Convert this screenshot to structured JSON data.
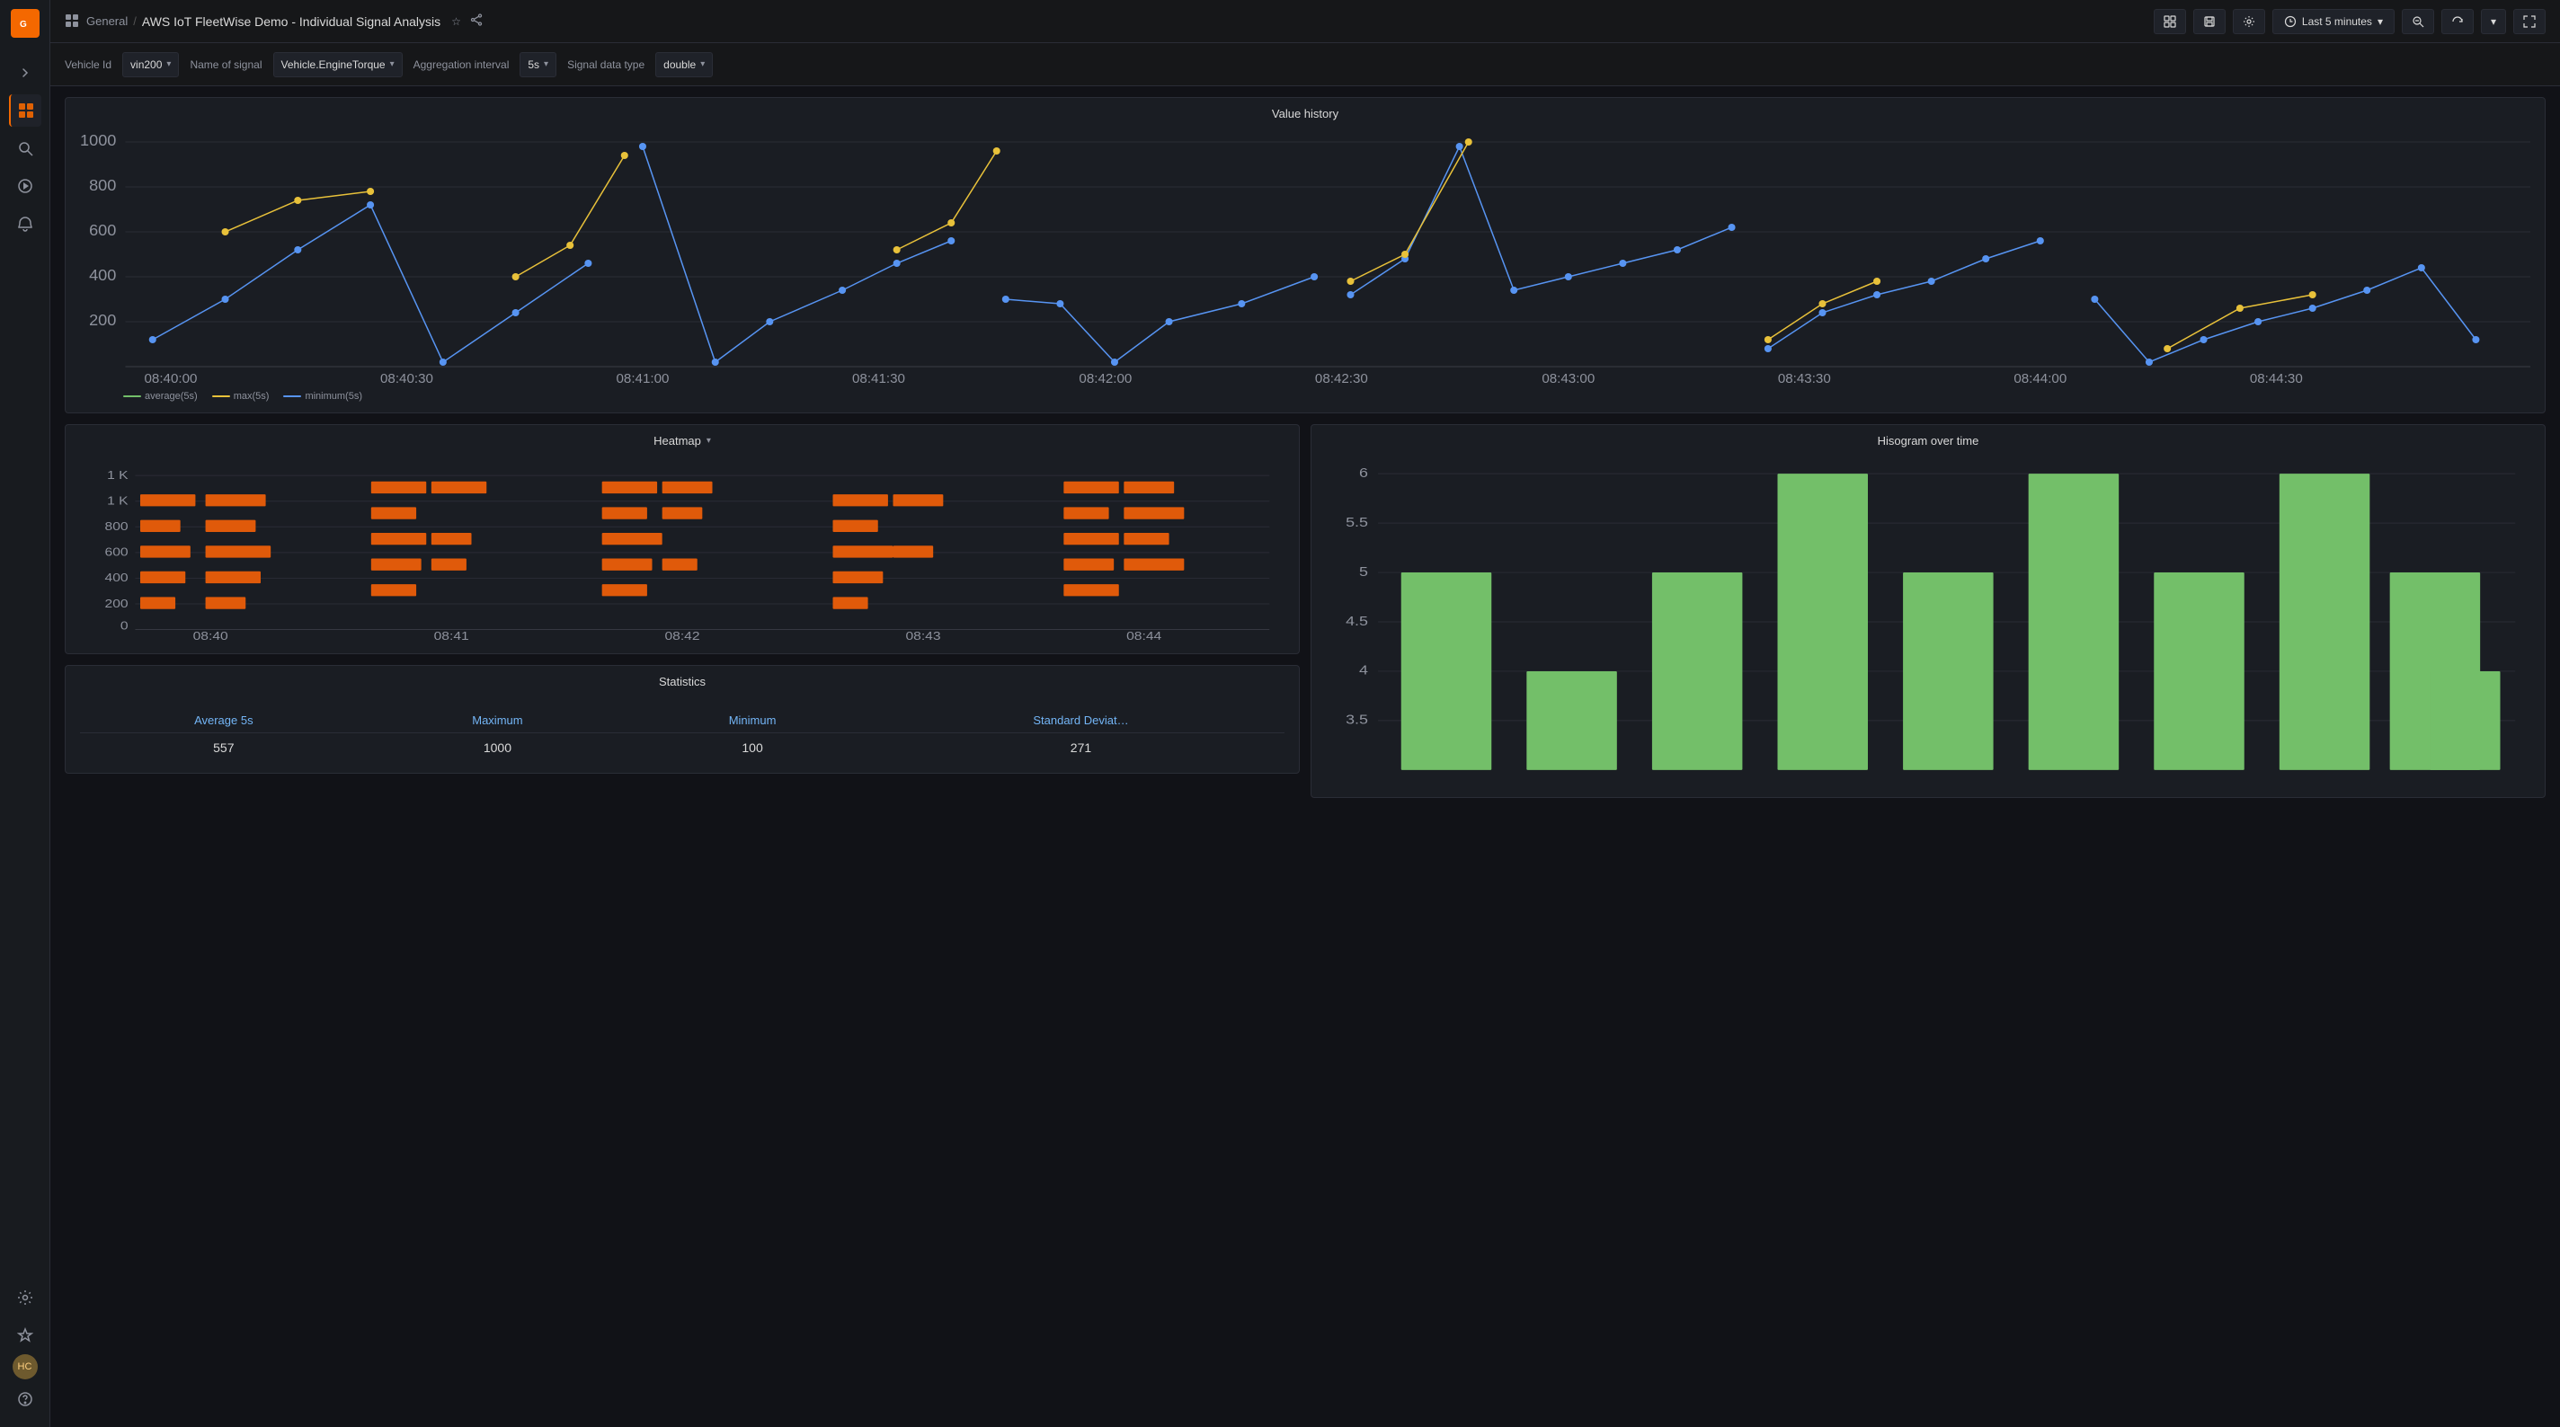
{
  "app": {
    "name": "Grafana",
    "breadcrumb": {
      "section": "General",
      "separator": "/",
      "title": "AWS IoT FleetWise Demo - Individual Signal Analysis"
    }
  },
  "toolbar": {
    "timeRange": "Last 5 minutes",
    "zoomOut": "Zoom out",
    "refresh": "Refresh",
    "chevron": "▾",
    "fullscreen": "⛶"
  },
  "filters": [
    {
      "label": "Vehicle Id",
      "value": "vin200",
      "key": "vehicle_id"
    },
    {
      "label": "Name of signal",
      "value": "Vehicle.EngineTorque",
      "key": "signal_name"
    },
    {
      "label": "Aggregation interval",
      "value": "5s",
      "key": "agg_interval"
    },
    {
      "label": "Signal data type",
      "value": "double",
      "key": "data_type"
    }
  ],
  "panels": {
    "valueHistory": {
      "title": "Value history",
      "yAxis": [
        "1000",
        "800",
        "600",
        "400",
        "200"
      ],
      "xAxis": [
        "08:40:00",
        "08:40:30",
        "08:41:00",
        "08:41:30",
        "08:42:00",
        "08:42:30",
        "08:43:00",
        "08:43:30",
        "08:44:00",
        "08:44:30"
      ],
      "legend": [
        {
          "label": "average(5s)",
          "color": "#73bf69"
        },
        {
          "label": "max(5s)",
          "color": "#e8c13a"
        },
        {
          "label": "minimum(5s)",
          "color": "#5794f2"
        }
      ]
    },
    "heatmap": {
      "title": "Heatmap",
      "hasChevron": true,
      "yAxis": [
        "1 K",
        "1 K",
        "800",
        "600",
        "400",
        "200",
        "0"
      ],
      "xAxis": [
        "08:40",
        "08:41",
        "08:42",
        "08:43",
        "08:44"
      ]
    },
    "statistics": {
      "title": "Statistics",
      "columns": [
        "Average 5s",
        "Maximum",
        "Minimum",
        "Standard Deviat…"
      ],
      "values": [
        "557",
        "1000",
        "100",
        "271"
      ]
    },
    "histogram": {
      "title": "Hisogram over time",
      "yAxis": [
        "6",
        "5.5",
        "5",
        "4.5",
        "4",
        "3.5"
      ],
      "bars": [
        5,
        4,
        5,
        6,
        5,
        6,
        5,
        6,
        5,
        4
      ]
    }
  },
  "sidebar": {
    "items": [
      {
        "icon": "grid",
        "label": "Dashboards",
        "active": true
      },
      {
        "icon": "search",
        "label": "Search"
      },
      {
        "icon": "compass",
        "label": "Explore"
      },
      {
        "icon": "bell",
        "label": "Alerting"
      }
    ],
    "bottom": [
      {
        "icon": "gear",
        "label": "Configuration"
      },
      {
        "icon": "shield",
        "label": "Server Admin"
      },
      {
        "icon": "avatar",
        "label": "User"
      },
      {
        "icon": "question",
        "label": "Help"
      }
    ]
  }
}
